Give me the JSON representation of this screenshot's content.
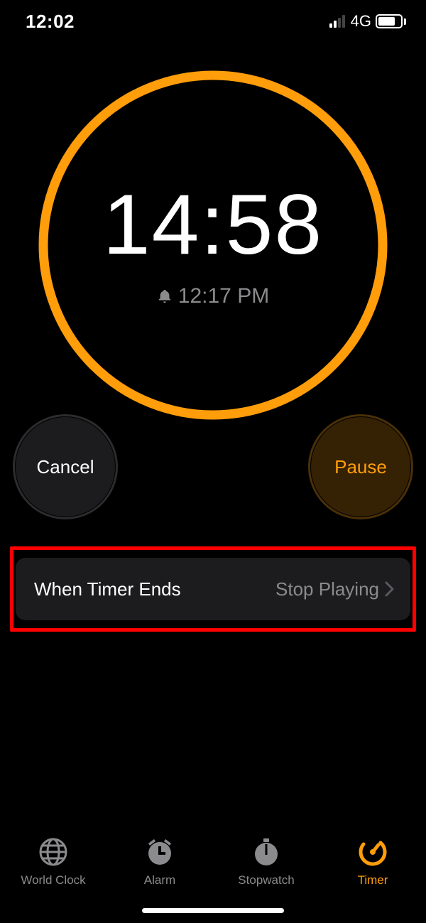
{
  "status": {
    "time": "12:02",
    "network_label": "4G"
  },
  "timer": {
    "remaining": "14:58",
    "end_time": "12:17 PM",
    "progress_fraction": 1.0,
    "accent_color": "#ff9d0a"
  },
  "controls": {
    "cancel_label": "Cancel",
    "pause_label": "Pause"
  },
  "when_ends": {
    "label": "When Timer Ends",
    "value": "Stop Playing"
  },
  "tabs": {
    "world_clock": "World Clock",
    "alarm": "Alarm",
    "stopwatch": "Stopwatch",
    "timer": "Timer",
    "active": "timer"
  }
}
